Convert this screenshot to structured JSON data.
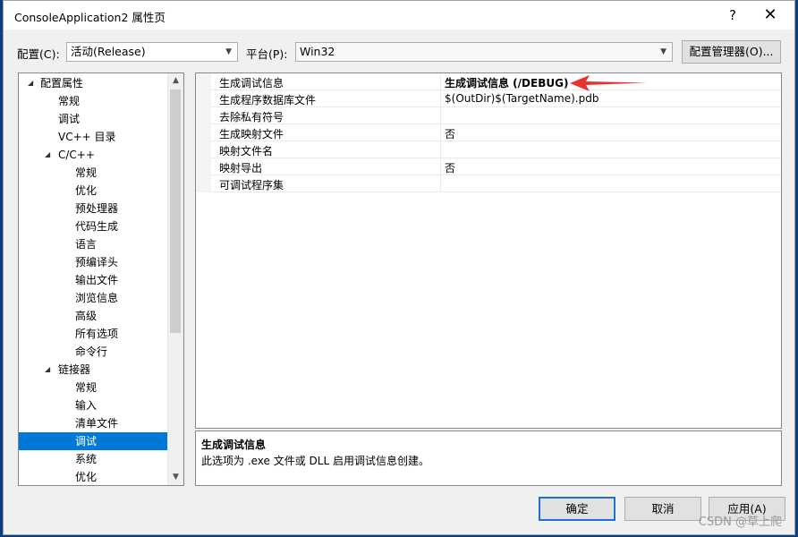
{
  "window": {
    "title": "ConsoleApplication2 属性页"
  },
  "titlebar": {
    "help_glyph": "?",
    "close_glyph": "✕"
  },
  "config_bar": {
    "config_label": "配置(C):",
    "config_value": "活动(Release)",
    "platform_label": "平台(P):",
    "platform_value": "Win32",
    "manager_button": "配置管理器(O)..."
  },
  "tree": {
    "items": [
      {
        "label": "配置属性",
        "expanded": true
      },
      {
        "label": "常规"
      },
      {
        "label": "调试"
      },
      {
        "label": "VC++ 目录"
      },
      {
        "label": "C/C++",
        "expanded": true
      },
      {
        "label": "常规"
      },
      {
        "label": "优化"
      },
      {
        "label": "预处理器"
      },
      {
        "label": "代码生成"
      },
      {
        "label": "语言"
      },
      {
        "label": "预编译头"
      },
      {
        "label": "输出文件"
      },
      {
        "label": "浏览信息"
      },
      {
        "label": "高级"
      },
      {
        "label": "所有选项"
      },
      {
        "label": "命令行"
      },
      {
        "label": "链接器",
        "expanded": true
      },
      {
        "label": "常规"
      },
      {
        "label": "输入"
      },
      {
        "label": "清单文件"
      },
      {
        "label": "调试",
        "selected": true
      },
      {
        "label": "系统"
      },
      {
        "label": "优化"
      }
    ]
  },
  "grid": {
    "rows": [
      {
        "name": "生成调试信息",
        "value": "生成调试信息 (/DEBUG)",
        "bold": true
      },
      {
        "name": "生成程序数据库文件",
        "value": "$(OutDir)$(TargetName).pdb"
      },
      {
        "name": "去除私有符号",
        "value": ""
      },
      {
        "name": "生成映射文件",
        "value": "否"
      },
      {
        "name": "映射文件名",
        "value": ""
      },
      {
        "name": "映射导出",
        "value": "否"
      },
      {
        "name": "可调试程序集",
        "value": ""
      }
    ]
  },
  "description": {
    "title": "生成调试信息",
    "text": "此选项为 .exe 文件或 DLL 启用调试信息创建。"
  },
  "buttons": {
    "ok": "确定",
    "cancel": "取消",
    "apply": "应用(A)"
  },
  "watermark": "CSDN @草上爬",
  "colors": {
    "selection": "#0078d7",
    "annotation_arrow": "#e8322f",
    "default_button_border": "#1e72d4"
  },
  "icons": {
    "expanded": "expanded-triangle-icon",
    "dropdown": "chevron-down-icon",
    "annotation": "red-arrow-annotation"
  }
}
